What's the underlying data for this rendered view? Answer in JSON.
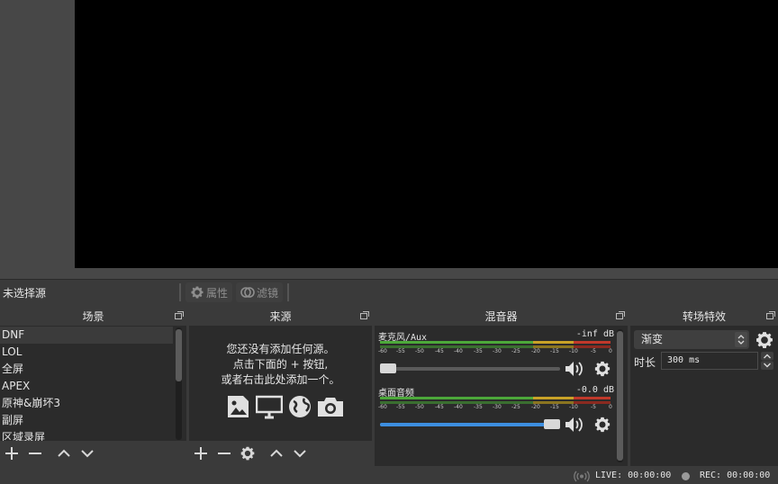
{
  "context_bar": {
    "status_label": "未选择源",
    "properties_label": "属性",
    "filters_label": "滤镜"
  },
  "scenes": {
    "title": "场景",
    "items": [
      "DNF",
      "LOL",
      "全屏",
      "APEX",
      "原神&崩坏3",
      "副屏",
      "区域录屏"
    ],
    "selected": "DNF"
  },
  "sources": {
    "title": "来源",
    "empty_line1": "您还没有添加任何源。",
    "empty_line2": "点击下面的 + 按钮,",
    "empty_line3": "或者右击此处添加一个。"
  },
  "mixer": {
    "title": "混音器",
    "scale_ticks": [
      "-60",
      "-55",
      "-50",
      "-45",
      "-40",
      "-35",
      "-30",
      "-25",
      "-20",
      "-15",
      "-10",
      "-5",
      "0"
    ],
    "channels": [
      {
        "name": "麦克风/Aux",
        "db": "-inf dB",
        "volume_fraction": 0.0
      },
      {
        "name": "桌面音频",
        "db": "-0.0 dB",
        "volume_fraction": 1.0
      }
    ]
  },
  "transitions": {
    "title": "转场特效",
    "selected": "渐变",
    "duration_label": "时长",
    "duration_value": "300 ms"
  },
  "status": {
    "live": "LIVE: 00:00:00",
    "rec": "REC: 00:00:00"
  },
  "colors": {
    "meter_green": "#4ca83a",
    "meter_yellow": "#c9a227",
    "meter_red": "#c0392b",
    "slider_blue": "#3d8fe0"
  }
}
